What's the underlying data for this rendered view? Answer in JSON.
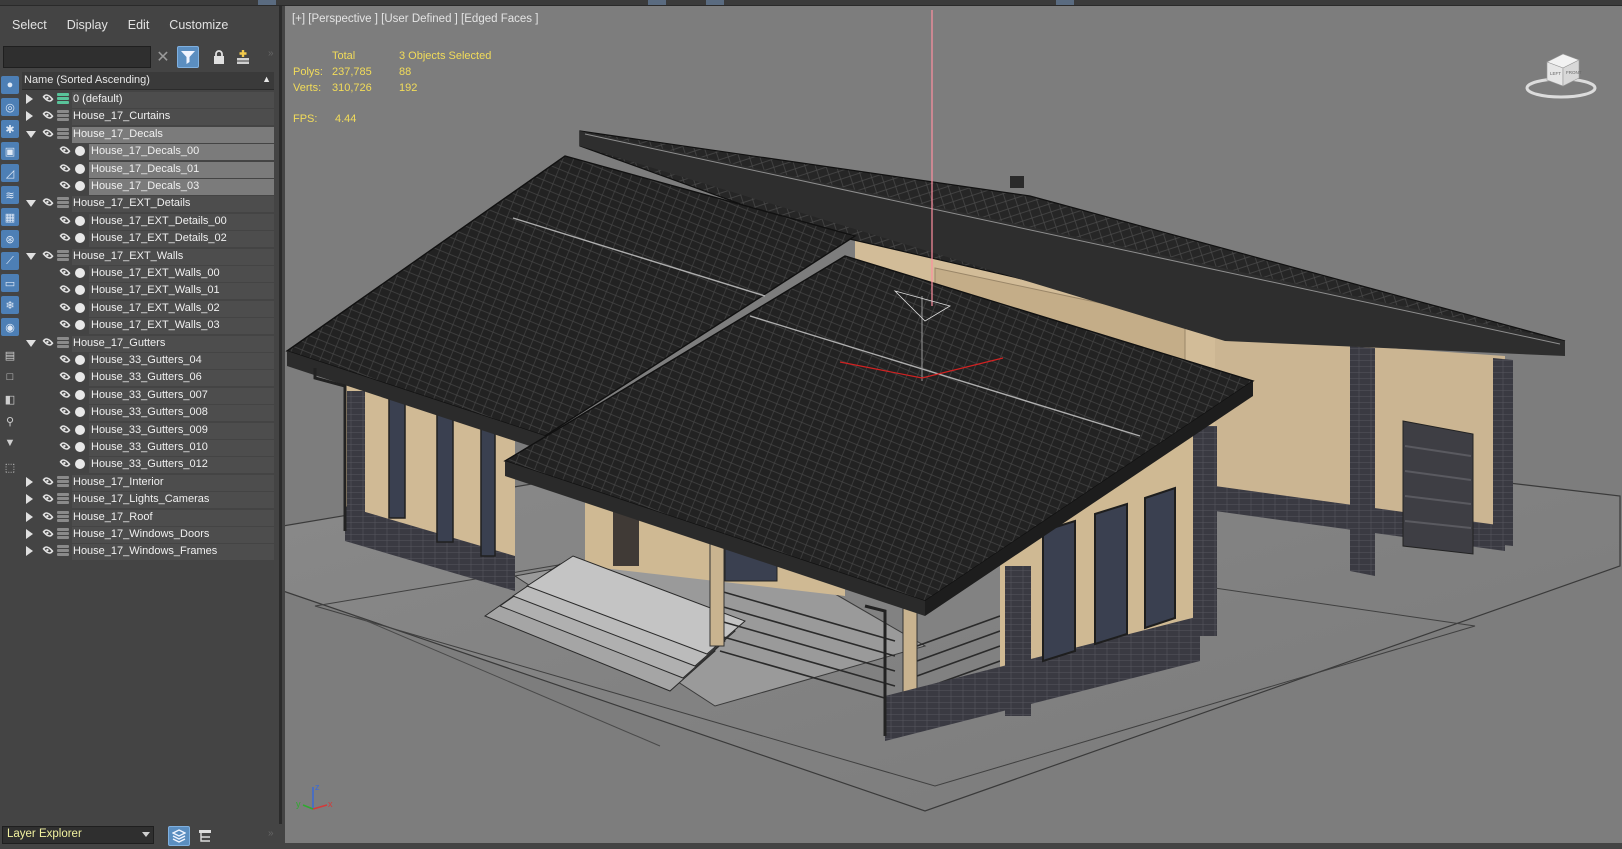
{
  "menu": [
    "Select",
    "Display",
    "Edit",
    "Customize"
  ],
  "toolbar": {
    "search_placeholder": "",
    "clear_icon": "close-icon",
    "filter_icon": "filter-icon",
    "lock_icon": "lock-icon",
    "new_layer_icon": "add-layer-icon"
  },
  "sidebar_icons": [
    "display-none-icon",
    "geometry-icon",
    "lights-icon",
    "cameras-icon",
    "helpers-icon",
    "spacewarps-icon",
    "groups-icon",
    "xrefs-icon",
    "bones-icon",
    "containers-icon",
    "frozen-icon",
    "hidden-icon",
    "display-all-icon",
    "invert-icon",
    "select-none-icon",
    "filter-funnel-icon",
    "find-icon",
    "options-icon"
  ],
  "tree": {
    "header": "Name (Sorted Ascending)",
    "rows": [
      {
        "label": "0 (default)",
        "level": 0,
        "state": "collapsed",
        "type": "default-layer"
      },
      {
        "label": "House_17_Curtains",
        "level": 0,
        "state": "collapsed",
        "type": "layer"
      },
      {
        "label": "House_17_Decals",
        "level": 0,
        "state": "expanded",
        "type": "layer",
        "selected": true
      },
      {
        "label": "House_17_Decals_00",
        "level": 1,
        "type": "object",
        "selected": true
      },
      {
        "label": "House_17_Decals_01",
        "level": 1,
        "type": "object",
        "selected": true
      },
      {
        "label": "House_17_Decals_03",
        "level": 1,
        "type": "object",
        "selected": true
      },
      {
        "label": "House_17_EXT_Details",
        "level": 0,
        "state": "expanded",
        "type": "layer"
      },
      {
        "label": "House_17_EXT_Details_00",
        "level": 1,
        "type": "object"
      },
      {
        "label": "House_17_EXT_Details_02",
        "level": 1,
        "type": "object"
      },
      {
        "label": "House_17_EXT_Walls",
        "level": 0,
        "state": "expanded",
        "type": "layer"
      },
      {
        "label": "House_17_EXT_Walls_00",
        "level": 1,
        "type": "object"
      },
      {
        "label": "House_17_EXT_Walls_01",
        "level": 1,
        "type": "object"
      },
      {
        "label": "House_17_EXT_Walls_02",
        "level": 1,
        "type": "object"
      },
      {
        "label": "House_17_EXT_Walls_03",
        "level": 1,
        "type": "object"
      },
      {
        "label": "House_17_Gutters",
        "level": 0,
        "state": "expanded",
        "type": "layer"
      },
      {
        "label": "House_33_Gutters_04",
        "level": 1,
        "type": "object"
      },
      {
        "label": "House_33_Gutters_06",
        "level": 1,
        "type": "object"
      },
      {
        "label": "House_33_Gutters_007",
        "level": 1,
        "type": "object"
      },
      {
        "label": "House_33_Gutters_008",
        "level": 1,
        "type": "object"
      },
      {
        "label": "House_33_Gutters_009",
        "level": 1,
        "type": "object"
      },
      {
        "label": "House_33_Gutters_010",
        "level": 1,
        "type": "object"
      },
      {
        "label": "House_33_Gutters_012",
        "level": 1,
        "type": "object"
      },
      {
        "label": "House_17_Interior",
        "level": 0,
        "state": "collapsed",
        "type": "layer"
      },
      {
        "label": "House_17_Lights_Cameras",
        "level": 0,
        "state": "collapsed",
        "type": "layer"
      },
      {
        "label": "House_17_Roof",
        "level": 0,
        "state": "collapsed",
        "type": "layer"
      },
      {
        "label": "House_17_Windows_Doors",
        "level": 0,
        "state": "collapsed",
        "type": "layer"
      },
      {
        "label": "House_17_Windows_Frames",
        "level": 0,
        "state": "collapsed",
        "type": "layer"
      }
    ]
  },
  "footer": {
    "explorer": "Layer Explorer",
    "layers_icon": "layers-icon",
    "hierarchy_icon": "hierarchy-icon"
  },
  "viewport": {
    "label": "[+] [Perspective ] [User Defined ] [Edged Faces ]",
    "stats": {
      "total_label": "Total",
      "selected_label": "3 Objects Selected",
      "polys_label": "Polys:",
      "polys_total": "237,785",
      "polys_selected": "88",
      "verts_label": "Verts:",
      "verts_total": "310,726",
      "verts_selected": "192",
      "fps_label": "FPS:",
      "fps_value": "4.44"
    },
    "viewcube_labels": {
      "left": "LEFT",
      "front": "FRONT"
    },
    "axis_labels": {
      "x": "x",
      "y": "y",
      "z": "z"
    }
  },
  "colors": {
    "panel_bg": "#444444",
    "viewport_bg": "#7d7d7d",
    "selection_bg": "#7b7b7b",
    "accent_blue": "#5b8ec0",
    "stats_yellow": "#f2dc5a",
    "roof": "#2a2a2a",
    "wall_beige": "#cdb896",
    "brick_dark": "#3e3e44"
  }
}
